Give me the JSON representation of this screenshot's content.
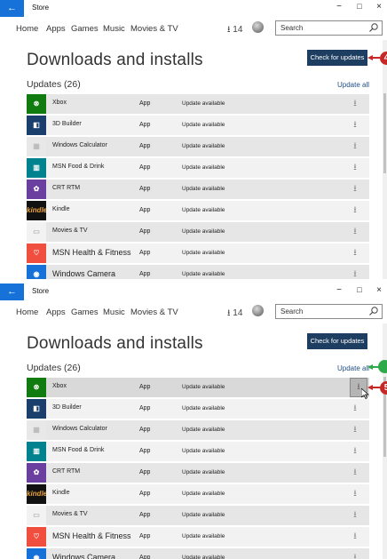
{
  "window": {
    "title": "Store",
    "back_label": "←",
    "minimize": "−",
    "maximize": "□",
    "close": "×"
  },
  "nav": {
    "items": [
      "Home",
      "Apps",
      "Games",
      "Music",
      "Movies & TV"
    ],
    "downloads_label": "14",
    "search_placeholder": "Search"
  },
  "page": {
    "title": "Downloads and installs",
    "check_button": "Check for updates",
    "updates_heading": "Updates (26)",
    "update_all": "Update all"
  },
  "apps": [
    {
      "name": "Xbox",
      "type": "App",
      "status": "Update available",
      "icon_color": "#107c10",
      "icon_glyph": "⊗"
    },
    {
      "name": "3D Builder",
      "type": "App",
      "status": "Update available",
      "icon_color": "#1b3f6d",
      "icon_glyph": "◧"
    },
    {
      "name": "Windows Calculator",
      "type": "App",
      "status": "Update available",
      "icon_color": "#e8e8e8",
      "icon_glyph": "▦"
    },
    {
      "name": "MSN Food & Drink",
      "type": "App",
      "status": "Update available",
      "icon_color": "#00838f",
      "icon_glyph": "▥"
    },
    {
      "name": "CRT RTM",
      "type": "App",
      "status": "Update available",
      "icon_color": "#6b3fa0",
      "icon_glyph": "✿"
    },
    {
      "name": "Kindle",
      "type": "App",
      "status": "Update available",
      "icon_color": "#111111",
      "icon_glyph": "kindle"
    },
    {
      "name": "Movies & TV",
      "type": "App",
      "status": "Update available",
      "icon_color": "#f2f2f2",
      "icon_glyph": "▭"
    },
    {
      "name": "MSN Health & Fitness",
      "type": "App",
      "status": "Update available",
      "icon_color": "#f04e3e",
      "icon_glyph": "♡"
    },
    {
      "name": "Windows Camera",
      "type": "App",
      "status": "Update available",
      "icon_color": "#1672d8",
      "icon_glyph": "◉"
    }
  ],
  "download_glyph": "⭳",
  "colors": {
    "accent": "#1672d8",
    "check_button": "#1e3e61",
    "callout_red": "#c62828",
    "callout_green": "#2eaa4a"
  }
}
